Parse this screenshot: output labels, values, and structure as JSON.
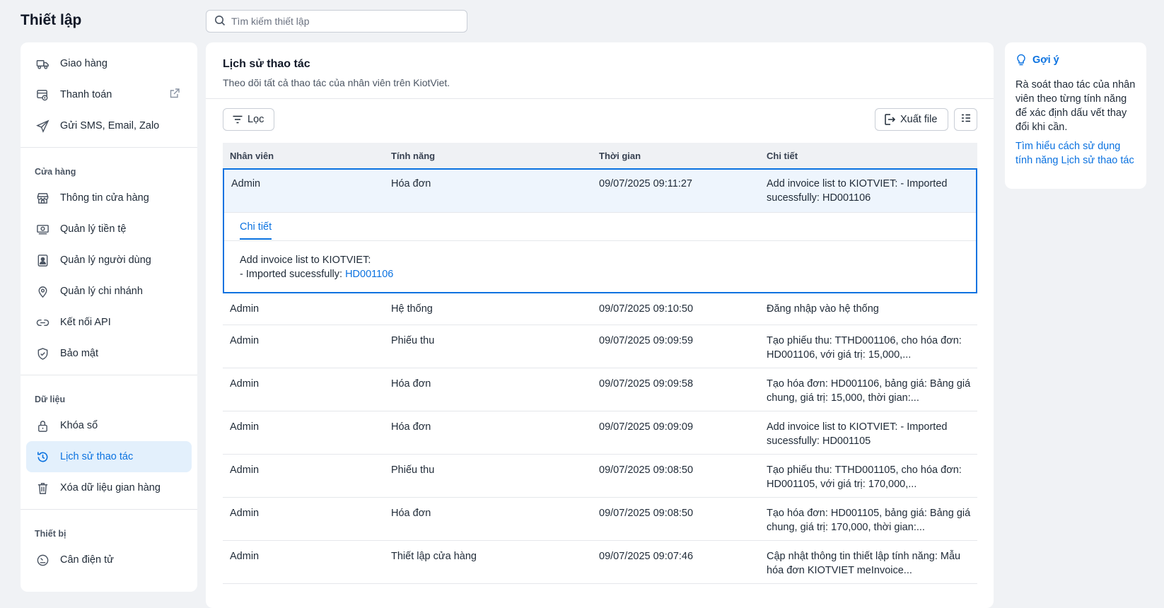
{
  "app": {
    "title": "Thiết lập"
  },
  "search": {
    "placeholder": "Tìm kiếm thiết lập"
  },
  "sidebar": {
    "group0": [
      {
        "label": "Giao hàng",
        "icon": "truck-icon"
      },
      {
        "label": "Thanh toán",
        "icon": "payment-icon",
        "external": true
      },
      {
        "label": "Gửi SMS, Email, Zalo",
        "icon": "send-icon"
      }
    ],
    "group1_title": "Cửa hàng",
    "group1": [
      {
        "label": "Thông tin cửa hàng",
        "icon": "store-icon"
      },
      {
        "label": "Quản lý tiền tệ",
        "icon": "money-icon"
      },
      {
        "label": "Quản lý người dùng",
        "icon": "user-badge-icon"
      },
      {
        "label": "Quản lý chi nhánh",
        "icon": "location-pin-icon"
      },
      {
        "label": "Kết nối API",
        "icon": "link-icon"
      },
      {
        "label": "Bảo mật",
        "icon": "shield-icon"
      }
    ],
    "group2_title": "Dữ liệu",
    "group2": [
      {
        "label": "Khóa sổ",
        "icon": "lock-icon"
      },
      {
        "label": "Lịch sử thao tác",
        "icon": "history-icon",
        "active": true
      },
      {
        "label": "Xóa dữ liệu gian hàng",
        "icon": "trash-icon"
      }
    ],
    "group3_title": "Thiết bị",
    "group3": [
      {
        "label": "Cân điện tử",
        "icon": "scale-icon"
      }
    ]
  },
  "main": {
    "title": "Lịch sử thao tác",
    "subtitle": "Theo dõi tất cả thao tác của nhân viên trên KiotViet.",
    "filter_label": "Lọc",
    "export_label": "Xuất file",
    "columns": [
      "Nhân viên",
      "Tính năng",
      "Thời gian",
      "Chi tiết"
    ],
    "expanded_row": {
      "user": "Admin",
      "feature": "Hóa đơn",
      "time": "09/07/2025 09:11:27",
      "detail": "Add invoice list to KIOTVIET: - Imported sucessfully: HD001106",
      "tab_label": "Chi tiết",
      "detail_line1": "Add invoice list to KIOTVIET:",
      "detail_line2": "- Imported sucessfully: ",
      "detail_link": "HD001106"
    },
    "rows": [
      {
        "user": "Admin",
        "feature": "Hệ thống",
        "time": "09/07/2025 09:10:50",
        "detail": "Đăng nhập vào hệ thống"
      },
      {
        "user": "Admin",
        "feature": "Phiếu thu",
        "time": "09/07/2025 09:09:59",
        "detail": "Tạo phiếu thu: TTHD001106, cho hóa đơn: HD001106, với giá trị: 15,000,..."
      },
      {
        "user": "Admin",
        "feature": "Hóa đơn",
        "time": "09/07/2025 09:09:58",
        "detail": "Tạo hóa đơn: HD001106, bảng giá: Bảng giá chung, giá trị: 15,000, thời gian:..."
      },
      {
        "user": "Admin",
        "feature": "Hóa đơn",
        "time": "09/07/2025 09:09:09",
        "detail": "Add invoice list to KIOTVIET: - Imported sucessfully: HD001105"
      },
      {
        "user": "Admin",
        "feature": "Phiếu thu",
        "time": "09/07/2025 09:08:50",
        "detail": "Tạo phiếu thu: TTHD001105, cho hóa đơn: HD001105, với giá trị: 170,000,..."
      },
      {
        "user": "Admin",
        "feature": "Hóa đơn",
        "time": "09/07/2025 09:08:50",
        "detail": "Tạo hóa đơn: HD001105, bảng giá: Bảng giá chung, giá trị: 170,000, thời gian:..."
      },
      {
        "user": "Admin",
        "feature": "Thiết lập cửa hàng",
        "time": "09/07/2025 09:07:46",
        "detail": "Cập nhật thông tin thiết lập tính năng: Mẫu hóa đơn KIOTVIET meInvoice..."
      }
    ]
  },
  "hint": {
    "title": "Gợi ý",
    "text": "Rà soát thao tác của nhân viên theo từng tính năng để xác định dấu vết thay đổi khi cần.",
    "link": "Tìm hiểu cách sử dụng tính năng Lịch sử thao tác"
  },
  "colors": {
    "accent": "#0b72e0",
    "active_bg": "#e3f0fc",
    "bg": "#f0f2f5"
  }
}
